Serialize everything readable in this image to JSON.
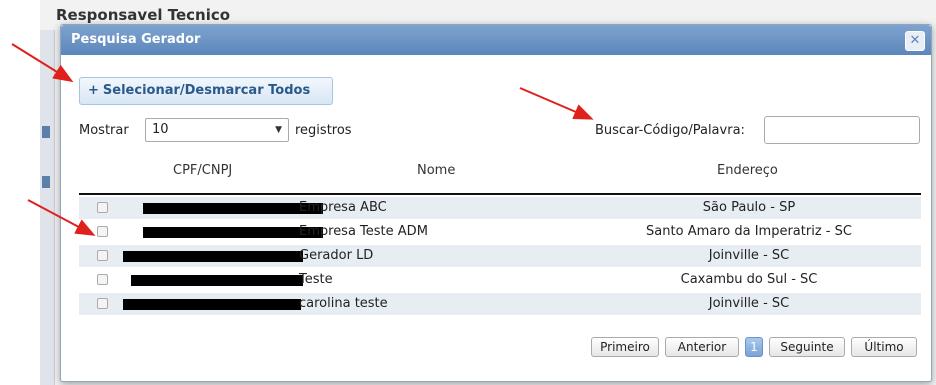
{
  "background": {
    "title": "Responsavel Tecnico"
  },
  "dialog": {
    "title": "Pesquisa Gerador",
    "close_glyph": "✕",
    "select_all_label": "Selecionar/Desmarcar Todos",
    "select_all_icon": "+",
    "show_prefix": "Mostrar",
    "page_size": "10",
    "show_suffix": "registros",
    "search_label": "Buscar-Código/Palavra:",
    "search_value": ""
  },
  "table": {
    "headers": {
      "cpf": "CPF/CNPJ",
      "name": "Nome",
      "address": "Endereço"
    },
    "rows": [
      {
        "name": "Empresa ABC",
        "address": "São Paulo - SP"
      },
      {
        "name": "Empresa Teste ADM",
        "address": "Santo Amaro da Imperatriz - SC"
      },
      {
        "name": "Gerador LD",
        "address": "Joinville - SC"
      },
      {
        "name": "Teste",
        "address": "Caxambu do Sul - SC"
      },
      {
        "name": "carolina teste",
        "address": "Joinville - SC"
      }
    ]
  },
  "pagination": {
    "first": "Primeiro",
    "prev": "Anterior",
    "current": "1",
    "next": "Seguinte",
    "last": "Último"
  },
  "colors": {
    "titlebar": "#6a92c4",
    "annotation_arrow": "#e0201c",
    "redaction": "#000000"
  },
  "icons": {
    "close": "close-icon",
    "dropdown": "chevron-down-icon",
    "add": "plus-icon"
  }
}
